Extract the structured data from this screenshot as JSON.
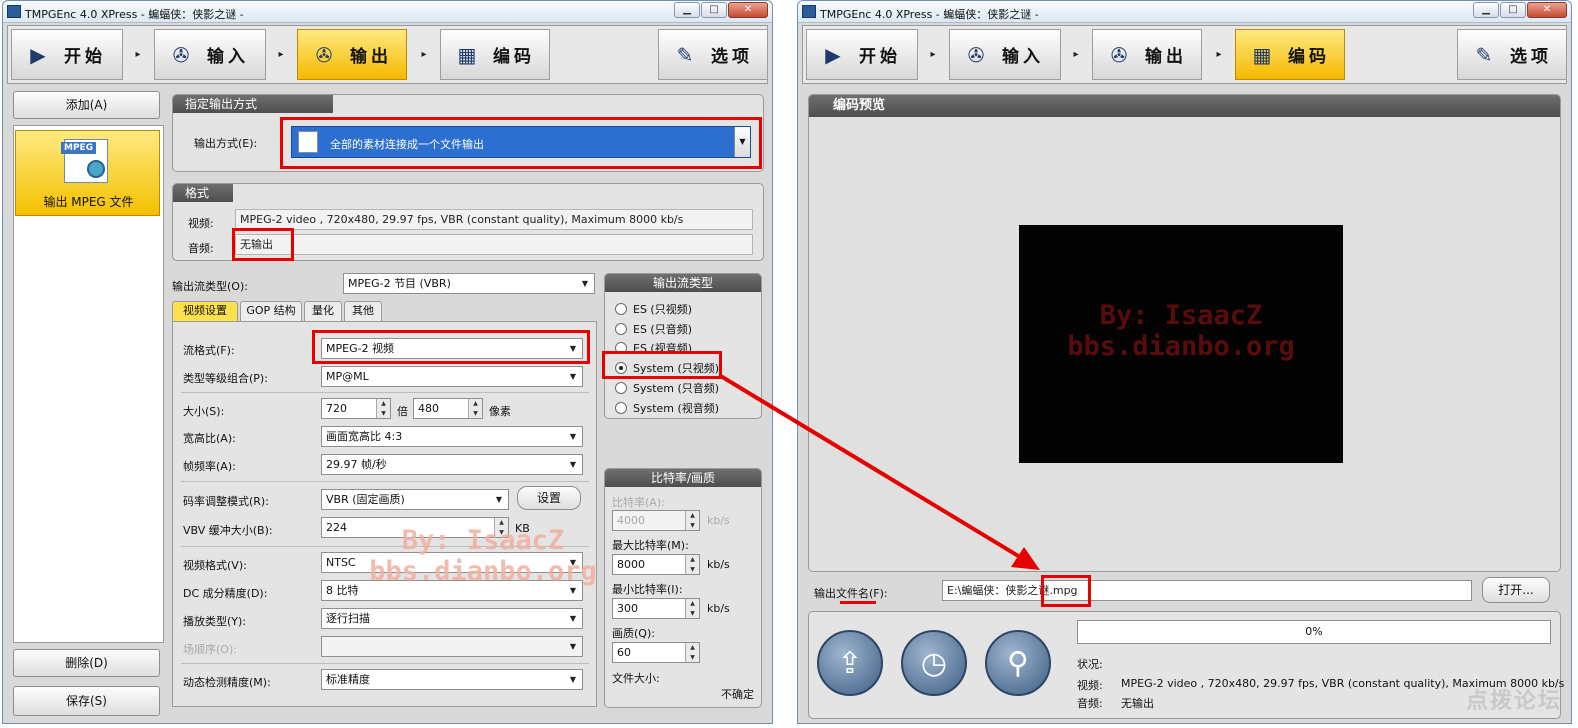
{
  "window_left": {
    "title": "TMPGEnc 4.0 XPress - 蝙蝠侠：侠影之谜 -",
    "nav": [
      {
        "label": "开始",
        "icon": "play-icon"
      },
      {
        "label": "输入",
        "icon": "film-reel-icon"
      },
      {
        "label": "输出",
        "icon": "film-reel-icon"
      },
      {
        "label": "编码",
        "icon": "filmstrip-icon"
      },
      {
        "label": "选项",
        "icon": "wrench-icon"
      }
    ],
    "sidebar": {
      "add_button": "添加(A)",
      "item_badge": "MPEG",
      "item_label": "输出 MPEG 文件",
      "delete_button": "删除(D)",
      "save_button": "保存(S)"
    },
    "output_method": {
      "header": "指定输出方式",
      "label": "输出方式(E):",
      "value": "全部的素材连接成一个文件输出"
    },
    "format": {
      "header": "格式",
      "video_label": "视频:",
      "video_value": "MPEG-2 video , 720x480, 29.97 fps, VBR (constant quality), Maximum 8000 kb/s",
      "audio_label": "音频:",
      "audio_value": "无输出"
    },
    "stream_type": {
      "label": "输出流类型(O):",
      "value": "MPEG-2 节目 (VBR)"
    },
    "tabs": [
      "视频设置",
      "GOP 结构",
      "量化",
      "其他"
    ],
    "video_settings": {
      "stream_format_label": "流格式(F):",
      "stream_format_value": "MPEG-2 视频",
      "profile_label": "类型等级组合(P):",
      "profile_value": "MP@ML",
      "size_label": "大小(S):",
      "width": "720",
      "times": "倍",
      "height": "480",
      "pixel_unit": "像素",
      "aspect_label": "宽高比(A):",
      "aspect_value": "画面宽高比 4:3",
      "framerate_label": "帧频率(A):",
      "framerate_value": "29.97 帧/秒",
      "rate_mode_label": "码率调整模式(R):",
      "rate_mode_value": "VBR (固定画质)",
      "settings_button": "设置",
      "vbv_label": "VBV 缓冲大小(B):",
      "vbv_value": "224",
      "vbv_unit": "KB",
      "video_format_label": "视频格式(V):",
      "video_format_value": "NTSC",
      "dc_label": "DC 成分精度(D):",
      "dc_value": "8 比特",
      "playback_label": "播放类型(Y):",
      "playback_value": "逐行扫描",
      "field_order_label": "场顺序(O):",
      "field_order_value": "",
      "motion_label": "动态检测精度(M):",
      "motion_value": "标准精度"
    },
    "stream_type_panel": {
      "header": "输出流类型",
      "options": [
        "ES (只视频)",
        "ES (只音频)",
        "ES (视音频)",
        "System (只视频)",
        "System (只音频)",
        "System (视音频)"
      ],
      "selected": "System (只视频)"
    },
    "bitrate_panel": {
      "header": "比特率/画质",
      "bitrate_label": "比特率(A):",
      "bitrate_value": "4000",
      "max_label": "最大比特率(M):",
      "max_value": "8000",
      "min_label": "最小比特率(I):",
      "min_value": "300",
      "unit": "kb/s",
      "quality_label": "画质(Q):",
      "quality_value": "60",
      "filesize_label": "文件大小:",
      "filesize_value": "不确定"
    },
    "watermark": [
      "By: IsaacZ",
      "bbs.dianbo.org"
    ]
  },
  "window_right": {
    "title": "TMPGEnc 4.0 XPress - 蝙蝠侠：侠影之谜 -",
    "nav": [
      {
        "label": "开始",
        "icon": "play-icon"
      },
      {
        "label": "输入",
        "icon": "film-reel-icon"
      },
      {
        "label": "输出",
        "icon": "film-reel-icon"
      },
      {
        "label": "编码",
        "icon": "filmstrip-icon"
      },
      {
        "label": "选项",
        "icon": "wrench-icon"
      }
    ],
    "preview_header": "编码预览",
    "watermark": [
      "By: IsaacZ",
      "bbs.dianbo.org"
    ],
    "output_file_label": "输出文件名(F):",
    "output_file_value": "E:\\蝙蝠侠：侠影之谜.mpg",
    "open_button": "打开...",
    "progress_text": "0%",
    "progress": 0,
    "status_label": "状况:",
    "video_label": "视频:",
    "video_value": "MPEG-2 video , 720x480, 29.97 fps, VBR (constant quality), Maximum 8000 kb/s",
    "audio_label": "音频:",
    "audio_value": "无输出",
    "action_icons": [
      "encode-start-icon",
      "clock-icon",
      "preview-search-icon"
    ],
    "corner_logo": "点拨论坛"
  },
  "colors": {
    "highlight": "#e60000",
    "selected_tab": "#ffe14d",
    "combo_selected": "#2d6fd1",
    "watermark_light": "#f0b0a0",
    "watermark_dark": "#5a0c0c"
  }
}
